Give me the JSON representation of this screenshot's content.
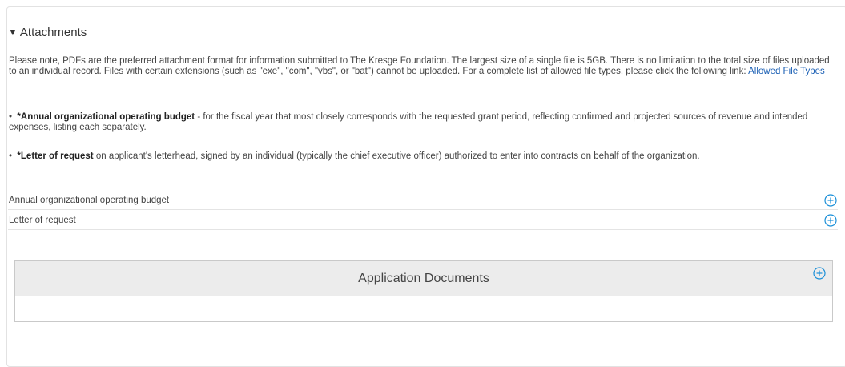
{
  "attachments": {
    "title": "Attachments",
    "note_text": "Please note, PDFs are the preferred attachment format for information submitted to The Kresge Foundation. The largest size of a single file is 5GB. There is no limitation to the total size of files uploaded to an individual record. Files with certain extensions (such as \"exe\", \"com\", \"vbs\", or \"bat\") cannot be uploaded. For a complete list of allowed file types, please click the following link: ",
    "note_link": "Allowed File Types",
    "bullets": [
      {
        "marker": "•",
        "bold": "*Annual organizational operating budget",
        "text": " - for the fiscal year that most closely corresponds with the requested grant period, reflecting confirmed and projected sources of revenue and intended expenses, listing each separately."
      },
      {
        "marker": "•",
        "bold": "*Letter of request",
        "text": " on applicant's letterhead, signed by an individual (typically the chief executive officer) authorized to enter into contracts on behalf of the organization."
      }
    ],
    "rows": [
      {
        "label": "Annual organizational operating budget"
      },
      {
        "label": "Letter of request"
      }
    ]
  },
  "application_documents": {
    "title": "Application Documents"
  },
  "colors": {
    "accent": "#1a8fd8",
    "link": "#1a5fb4",
    "header_bg": "#ececec"
  },
  "icons": {
    "collapse": "triangle-down-icon",
    "add": "plus-circle-icon"
  }
}
